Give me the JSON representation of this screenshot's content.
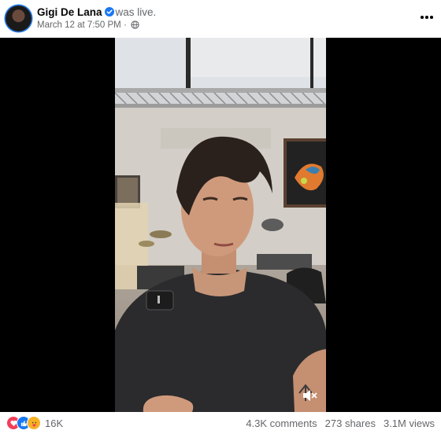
{
  "post": {
    "author": "Gigi De Lana",
    "status_text": "was live.",
    "date": "March 12 at 7:50 PM",
    "separator": "·",
    "privacy_icon": "globe-icon",
    "more_icon": "more-horizontal-icon"
  },
  "video": {
    "mute_icon": "volume-muted-icon"
  },
  "footer": {
    "reaction_icons": [
      "love-reaction-icon",
      "like-reaction-icon",
      "care-reaction-icon"
    ],
    "reaction_count": "16K",
    "comments": "4.3K comments",
    "shares": "273 shares",
    "views": "3.1M views"
  },
  "colors": {
    "accent": "#1877f2",
    "love": "#f33e58",
    "care": "#f7b125",
    "meta_text": "#65676b"
  }
}
